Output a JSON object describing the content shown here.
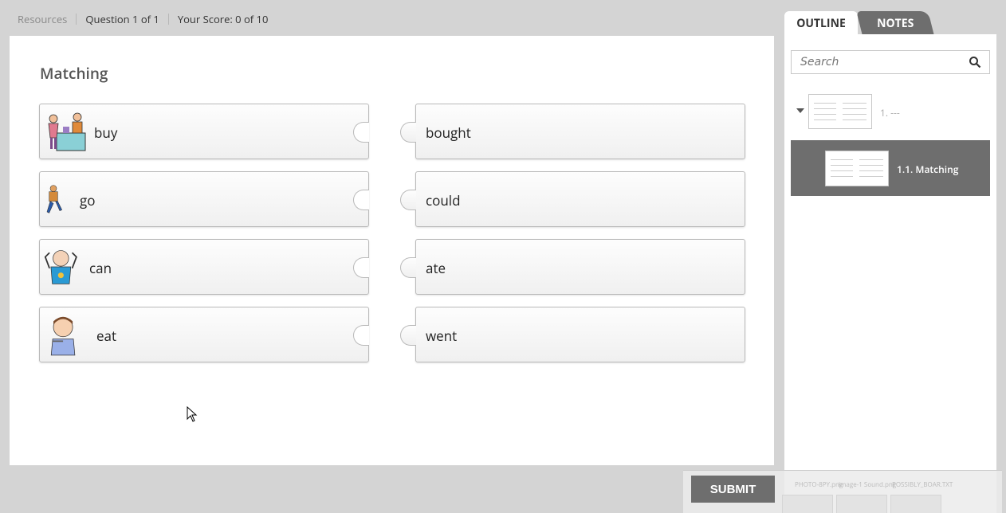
{
  "topbar": {
    "resources": "Resources",
    "question": "Question 1 of 1",
    "score": "Your Score: 0 of 10"
  },
  "slide": {
    "title": "Matching",
    "left_items": [
      {
        "label": "buy",
        "icon": "shopping-clipart"
      },
      {
        "label": "go",
        "icon": "walking-boy-clipart"
      },
      {
        "label": "can",
        "icon": "strong-man-clipart"
      },
      {
        "label": "eat",
        "icon": "boy-eating-clipart"
      }
    ],
    "right_items": [
      {
        "label": "bought"
      },
      {
        "label": "could"
      },
      {
        "label": "ate"
      },
      {
        "label": "went"
      }
    ]
  },
  "sidebar": {
    "tabs": [
      {
        "label": "OUTLINE",
        "active": true
      },
      {
        "label": "NOTES",
        "active": false
      }
    ],
    "search_placeholder": "Search",
    "outline": [
      {
        "label": "1. ---",
        "expanded": true
      },
      {
        "label": "1.1. Matching",
        "selected": true
      }
    ]
  },
  "submit": {
    "label": "SUBMIT",
    "background_labels": [
      "PHOTO-8PY.png",
      "image-1 Sound.png",
      "POSSIBLY_BOAR.TXT"
    ]
  },
  "colors": {
    "accent_gray": "#6e6e6e",
    "page_bg": "#d4d4d4"
  }
}
